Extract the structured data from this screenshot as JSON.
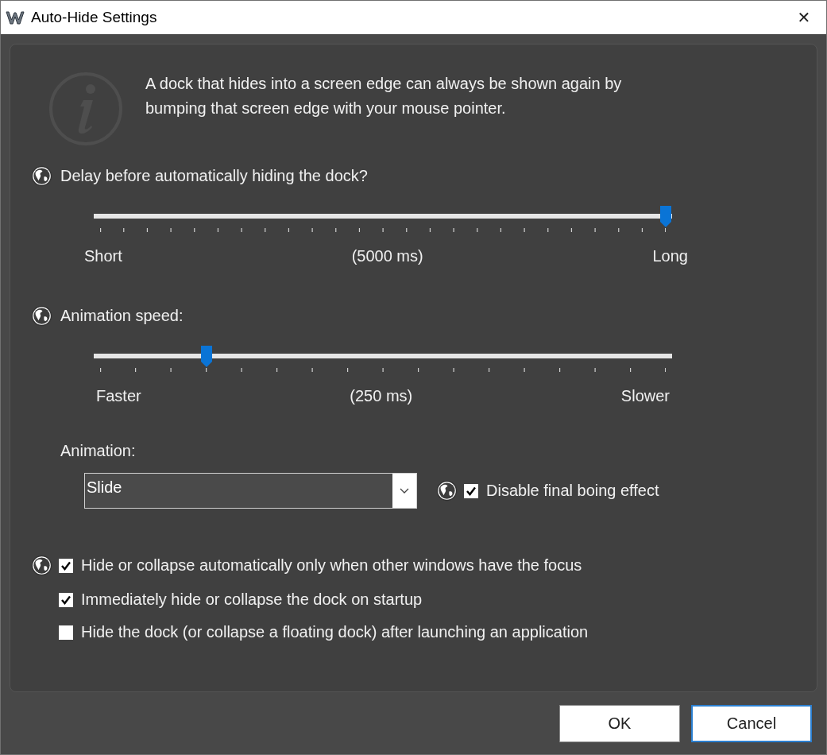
{
  "window": {
    "title": "Auto-Hide Settings",
    "close_glyph": "✕"
  },
  "info": {
    "text": "A dock that hides into a screen edge can always be shown again by bumping that screen edge with your mouse pointer."
  },
  "sliders": [
    {
      "label": "Delay before automatically hiding the dock?",
      "globe": true,
      "level": 1,
      "min_label": "Short",
      "reading": "(5000 ms)",
      "max_label": "Long"
    },
    {
      "label": "Animation speed:",
      "globe": true,
      "level": 0.1875,
      "min_label": "Faster",
      "reading": "(250 ms)",
      "max_label": "Slower"
    }
  ],
  "animation": {
    "label": "Animation:",
    "value": "Slide",
    "option": {
      "label": "Disable final boing effect",
      "checked": true,
      "globe": true
    }
  },
  "options": [
    {
      "label": "Hide or collapse automatically only when other windows have the focus",
      "checked": true,
      "globe": true
    },
    {
      "label": "Immediately hide or collapse the dock on startup",
      "checked": true,
      "globe": false
    },
    {
      "label": "Hide the dock (or collapse a floating dock) after launching an application",
      "checked": false,
      "globe": false
    }
  ],
  "buttons": [
    {
      "label": "OK",
      "selected": false
    },
    {
      "label": "Cancel",
      "selected": true
    }
  ]
}
